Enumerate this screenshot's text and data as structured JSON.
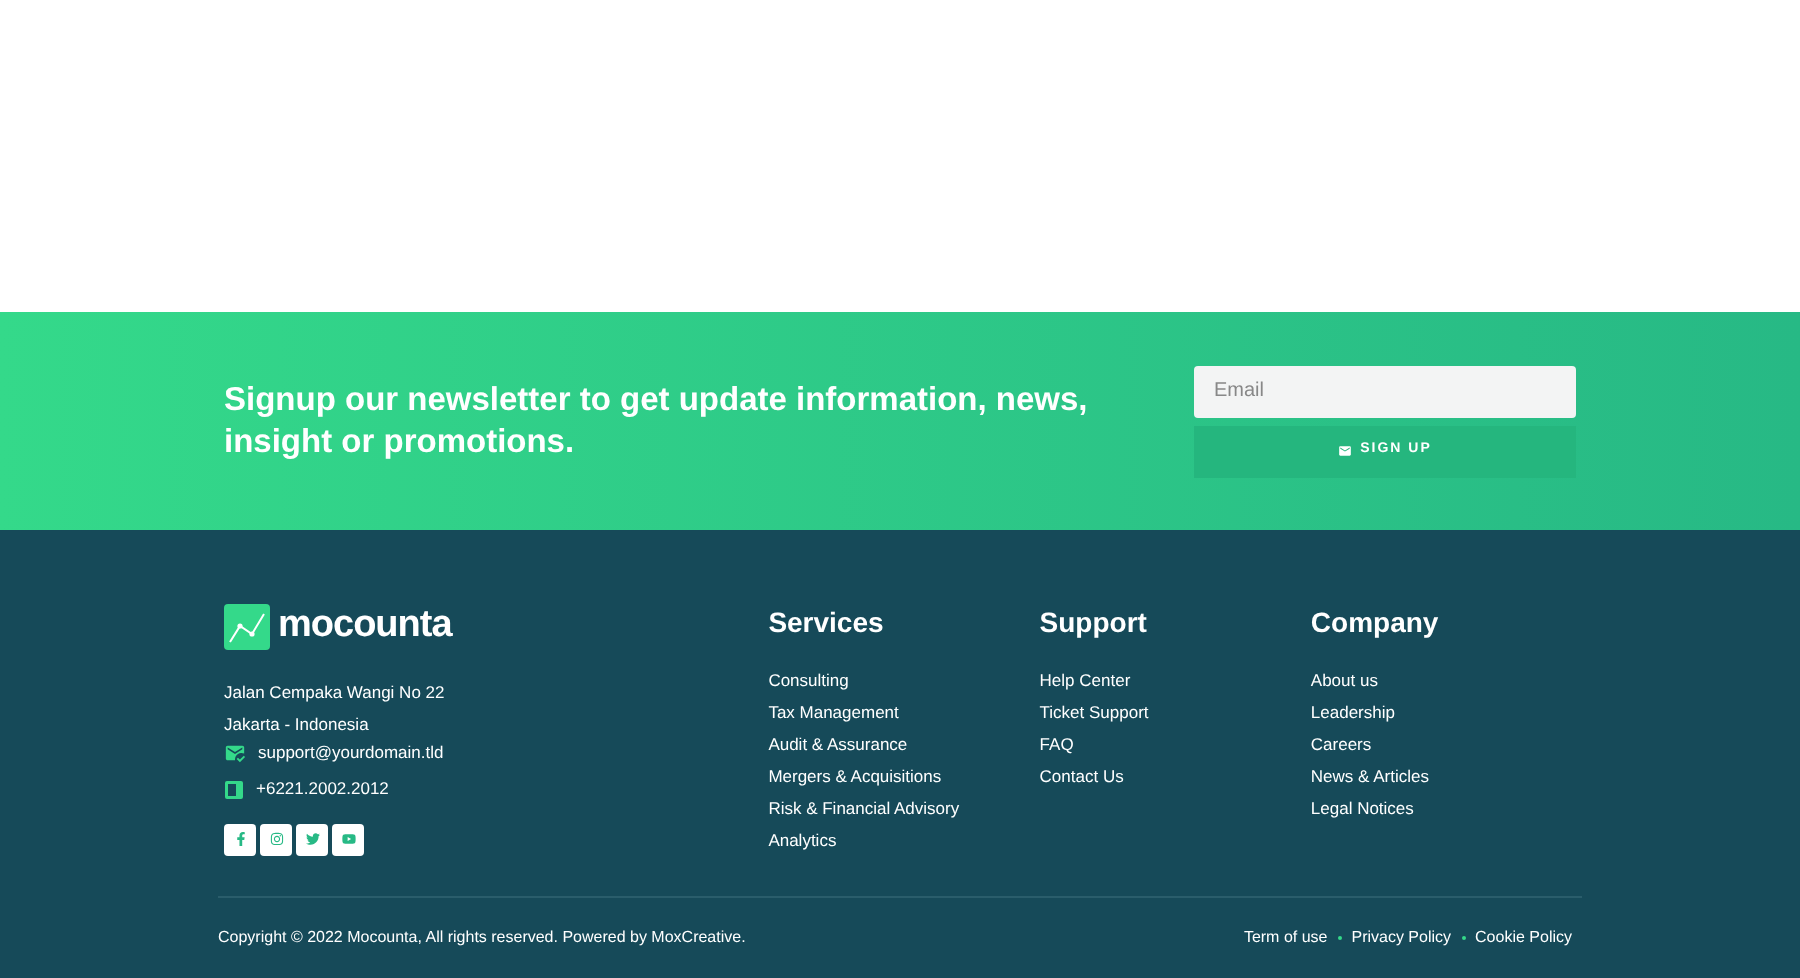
{
  "newsletter": {
    "heading": "Signup our newsletter to get update information, news, insight or promotions.",
    "email_placeholder": "Email",
    "button": "SIGN UP"
  },
  "brand": {
    "name": "mocounta",
    "address_lines": [
      "Jalan Cempaka Wangi No 22",
      "Jakarta - Indonesia"
    ],
    "email": "support@yourdomain.tld",
    "phone": "+6221.2002.2012",
    "social": [
      {
        "kind": "facebook"
      },
      {
        "kind": "instagram"
      },
      {
        "kind": "twitter"
      },
      {
        "kind": "youtube"
      }
    ]
  },
  "columns": [
    {
      "title": "Services",
      "links": [
        "Consulting",
        "Tax Management",
        "Audit & Assurance",
        "Mergers & Acquisitions",
        "Risk & Financial Advisory",
        "Analytics"
      ]
    },
    {
      "title": "Support",
      "links": [
        "Help Center",
        "Ticket Support",
        "FAQ",
        "Contact Us"
      ]
    },
    {
      "title": "Company",
      "links": [
        "About us",
        "Leadership",
        "Careers",
        "News & Articles",
        "Legal Notices"
      ]
    }
  ],
  "copyright": "Copyright © 2022 Mocounta, All rights reserved. Powered by MoxCreative.",
  "legal_links": [
    "Term of use",
    "Privacy Policy",
    "Cookie Policy"
  ]
}
